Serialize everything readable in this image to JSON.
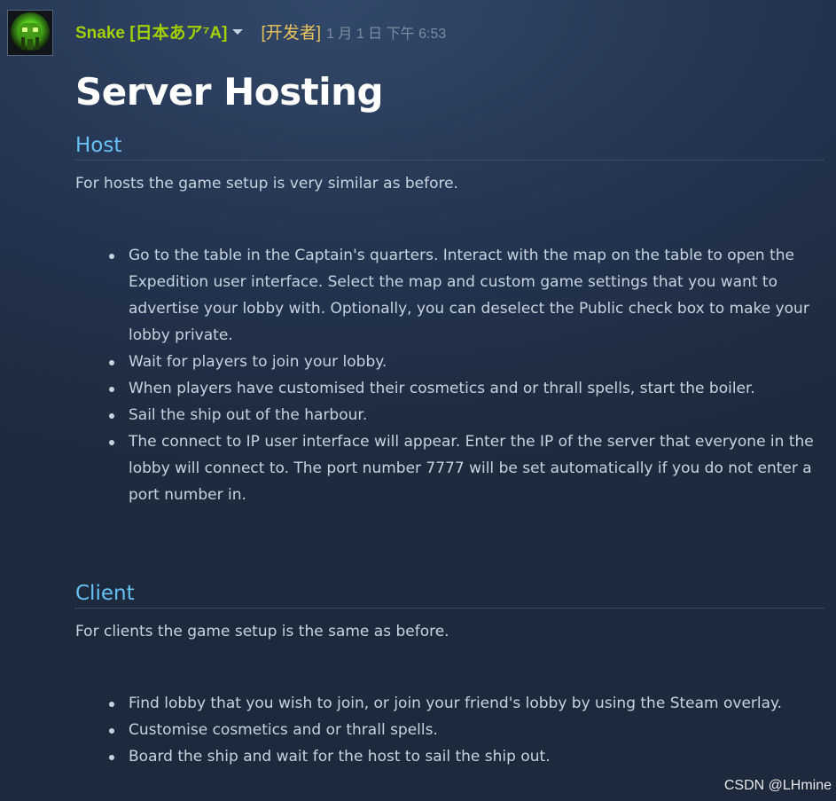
{
  "post": {
    "author": "Snake [日本あア⁷A]",
    "role_tag": "[开发者]",
    "date": "1 月 1 日 下午 6:53",
    "title": "Server Hosting"
  },
  "sections": {
    "host": {
      "heading": "Host",
      "intro": "For hosts the game setup is very similar as before.",
      "steps": [
        "Go to the table in the Captain's quarters. Interact with the map on the table to open the Expedition user interface. Select the map and custom game settings that you want to advertise your lobby with. Optionally, you can deselect the Public check box to make your lobby private.",
        "Wait for players to join your lobby.",
        "When players have customised their cosmetics and or thrall spells, start the boiler.",
        "Sail the ship out of the harbour.",
        "The connect to IP user interface will appear. Enter the IP of the server that everyone in the lobby will connect to. The port number 7777 will be set automatically if you do not enter a port number in."
      ]
    },
    "client": {
      "heading": "Client",
      "intro": "For clients the game setup is the same as before.",
      "steps": [
        "Find lobby that you wish to join, or join your friend's lobby by using the Steam overlay.",
        "Customise cosmetics and or thrall spells.",
        "Board the ship and wait for the host to sail the ship out."
      ]
    }
  },
  "watermark": "CSDN @LHmine",
  "colors": {
    "author": "#a3cf06",
    "role_tag": "#e9c45b",
    "heading": "#67c1f5",
    "body_text": "#c6d4df",
    "title": "#ffffff"
  },
  "icons": {
    "avatar": "green-robot-avatar",
    "dropdown": "caret-down-icon",
    "bullet": "bullet-dot"
  }
}
